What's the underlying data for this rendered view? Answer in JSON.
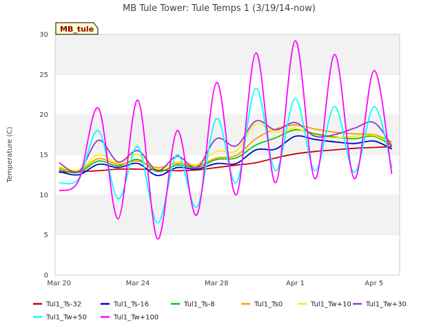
{
  "chart_data": {
    "type": "line",
    "title": "MB Tule Tower: Tule Temps 1 (3/19/14-now)",
    "ylabel": "Temperature (C)",
    "xlabel": "",
    "station_tag": "MB_tule",
    "ylim": [
      0,
      30
    ],
    "xlim": [
      -0.2,
      17.3
    ],
    "yticks": [
      0,
      5,
      10,
      15,
      20,
      25,
      30
    ],
    "xticks": [
      {
        "value": 0,
        "label": "Mar 20"
      },
      {
        "value": 4,
        "label": "Mar 24"
      },
      {
        "value": 8,
        "label": "Mar 28"
      },
      {
        "value": 12,
        "label": "Apr 1"
      },
      {
        "value": 16,
        "label": "Apr 5"
      }
    ],
    "x_units": "days since Mar 20",
    "grid": true,
    "legend_position": "bottom",
    "series": [
      {
        "name": "Tul1_Ts-32",
        "color": "#cc0000",
        "values": [
          [
            0,
            12.8
          ],
          [
            1,
            12.9
          ],
          [
            2,
            13.0
          ],
          [
            3,
            13.2
          ],
          [
            4,
            13.2
          ],
          [
            5,
            13.1
          ],
          [
            6,
            13.0
          ],
          [
            7,
            13.1
          ],
          [
            8,
            13.4
          ],
          [
            9,
            13.7
          ],
          [
            10,
            14.0
          ],
          [
            11,
            14.6
          ],
          [
            12,
            15.1
          ],
          [
            13,
            15.4
          ],
          [
            14,
            15.6
          ],
          [
            15,
            15.8
          ],
          [
            16,
            15.9
          ],
          [
            16.9,
            16.0
          ]
        ]
      },
      {
        "name": "Tul1_Ts-16",
        "color": "#0000cc",
        "values": [
          [
            0,
            12.9
          ],
          [
            1,
            12.5
          ],
          [
            2,
            13.8
          ],
          [
            3,
            13.4
          ],
          [
            4,
            13.9
          ],
          [
            5,
            12.4
          ],
          [
            6,
            13.4
          ],
          [
            7,
            13.2
          ],
          [
            8,
            13.9
          ],
          [
            9,
            13.9
          ],
          [
            10,
            15.6
          ],
          [
            11,
            15.7
          ],
          [
            12,
            17.3
          ],
          [
            13,
            16.9
          ],
          [
            14,
            16.6
          ],
          [
            15,
            16.4
          ],
          [
            16,
            16.7
          ],
          [
            16.9,
            15.7
          ]
        ]
      },
      {
        "name": "Tul1_Ts-8",
        "color": "#00cc00",
        "values": [
          [
            0,
            13.1
          ],
          [
            1,
            12.8
          ],
          [
            2,
            14.2
          ],
          [
            3,
            13.6
          ],
          [
            4,
            14.4
          ],
          [
            5,
            12.9
          ],
          [
            6,
            13.7
          ],
          [
            7,
            13.4
          ],
          [
            8,
            14.4
          ],
          [
            9,
            14.6
          ],
          [
            10,
            16.2
          ],
          [
            11,
            17.1
          ],
          [
            12,
            18.1
          ],
          [
            13,
            17.6
          ],
          [
            14,
            17.2
          ],
          [
            15,
            17.0
          ],
          [
            16,
            17.3
          ],
          [
            16.9,
            16.1
          ]
        ]
      },
      {
        "name": "Tul1_Ts0",
        "color": "#ff9900",
        "values": [
          [
            0,
            13.3
          ],
          [
            1,
            13.0
          ],
          [
            2,
            14.5
          ],
          [
            3,
            13.8
          ],
          [
            4,
            14.2
          ],
          [
            5,
            13.4
          ],
          [
            6,
            13.9
          ],
          [
            7,
            13.6
          ],
          [
            8,
            14.6
          ],
          [
            9,
            14.9
          ],
          [
            10,
            17.0
          ],
          [
            11,
            18.2
          ],
          [
            12,
            18.7
          ],
          [
            13,
            18.2
          ],
          [
            14,
            17.8
          ],
          [
            15,
            17.6
          ],
          [
            16,
            17.5
          ],
          [
            16.9,
            16.6
          ]
        ]
      },
      {
        "name": "Tul1_Tw+10",
        "color": "#ffee00",
        "values": [
          [
            0,
            13.5
          ],
          [
            1,
            13.1
          ],
          [
            2,
            15.0
          ],
          [
            3,
            14.0
          ],
          [
            4,
            15.0
          ],
          [
            5,
            13.2
          ],
          [
            6,
            14.1
          ],
          [
            7,
            13.8
          ],
          [
            8,
            15.4
          ],
          [
            9,
            15.5
          ],
          [
            10,
            18.8
          ],
          [
            11,
            17.8
          ],
          [
            12,
            18.3
          ],
          [
            13,
            17.4
          ],
          [
            14,
            17.1
          ],
          [
            15,
            17.3
          ],
          [
            16,
            17.4
          ],
          [
            16.9,
            16.3
          ]
        ]
      },
      {
        "name": "Tul1_Tw+30",
        "color": "#9933cc",
        "values": [
          [
            0,
            14.0
          ],
          [
            1,
            12.9
          ],
          [
            2,
            16.8
          ],
          [
            3,
            14.1
          ],
          [
            4,
            15.5
          ],
          [
            5,
            13.0
          ],
          [
            6,
            14.8
          ],
          [
            7,
            13.4
          ],
          [
            8,
            17.0
          ],
          [
            9,
            16.1
          ],
          [
            10,
            19.2
          ],
          [
            11,
            18.1
          ],
          [
            12,
            19.0
          ],
          [
            13,
            17.3
          ],
          [
            14,
            17.5
          ],
          [
            15,
            18.3
          ],
          [
            16,
            19.0
          ],
          [
            16.9,
            16.1
          ]
        ]
      },
      {
        "name": "Tul1_Tw+50",
        "color": "#00ffff",
        "values": [
          [
            0,
            11.5
          ],
          [
            1,
            12.0
          ],
          [
            2,
            18.0
          ],
          [
            3,
            9.5
          ],
          [
            4,
            16.0
          ],
          [
            5,
            6.5
          ],
          [
            6,
            15.0
          ],
          [
            7,
            8.5
          ],
          [
            8,
            19.5
          ],
          [
            9,
            11.5
          ],
          [
            10,
            23.3
          ],
          [
            11,
            13.0
          ],
          [
            12,
            22.0
          ],
          [
            13,
            13.0
          ],
          [
            14,
            21.0
          ],
          [
            15,
            12.8
          ],
          [
            16,
            21.0
          ],
          [
            16.9,
            13.4
          ]
        ]
      },
      {
        "name": "Tul1_Tw+100",
        "color": "#ff00ff",
        "values": [
          [
            0,
            10.5
          ],
          [
            1,
            11.8
          ],
          [
            2,
            20.8
          ],
          [
            3,
            7.0
          ],
          [
            4,
            21.8
          ],
          [
            5,
            4.5
          ],
          [
            6,
            18.0
          ],
          [
            7,
            7.5
          ],
          [
            8,
            24.0
          ],
          [
            9,
            10.0
          ],
          [
            10,
            27.7
          ],
          [
            11,
            11.5
          ],
          [
            12,
            29.2
          ],
          [
            13,
            12.0
          ],
          [
            14,
            27.5
          ],
          [
            15,
            12.0
          ],
          [
            16,
            25.5
          ],
          [
            16.9,
            12.6
          ]
        ]
      }
    ]
  }
}
